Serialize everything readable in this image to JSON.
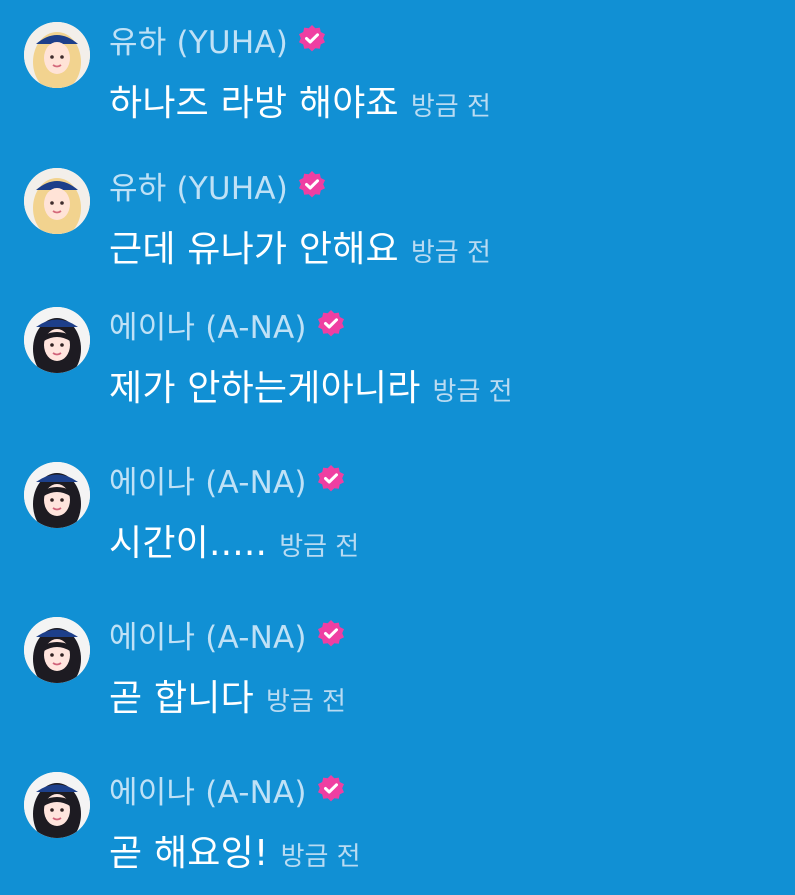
{
  "colors": {
    "background": "#1190d4",
    "name_text": "#bfe1f6",
    "message_text": "#ffffff",
    "time_text": "#b9dbf2",
    "verified_badge": "#ef3fa2"
  },
  "messages": [
    {
      "author": "유하 (YUHA)",
      "text": "하나즈 라방 해야죠",
      "time": "방금 전",
      "avatar_icon": "blonde-avatar",
      "badge_icon": "verified-badge-icon"
    },
    {
      "author": "유하 (YUHA)",
      "text": "근데 유나가 안해요",
      "time": "방금 전",
      "avatar_icon": "blonde-avatar",
      "badge_icon": "verified-badge-icon"
    },
    {
      "author": "에이나 (A-NA)",
      "text": "제가 안하는게아니라",
      "time": "방금 전",
      "avatar_icon": "dark-hair-avatar",
      "badge_icon": "verified-badge-icon"
    },
    {
      "author": "에이나 (A-NA)",
      "text": "시간이.....",
      "time": "방금 전",
      "avatar_icon": "dark-hair-avatar",
      "badge_icon": "verified-badge-icon"
    },
    {
      "author": "에이나 (A-NA)",
      "text": "곧 합니다",
      "time": "방금 전",
      "avatar_icon": "dark-hair-avatar",
      "badge_icon": "verified-badge-icon"
    },
    {
      "author": "에이나 (A-NA)",
      "text": "곧 해요잉!",
      "time": "방금 전",
      "avatar_icon": "dark-hair-avatar",
      "badge_icon": "verified-badge-icon"
    }
  ]
}
